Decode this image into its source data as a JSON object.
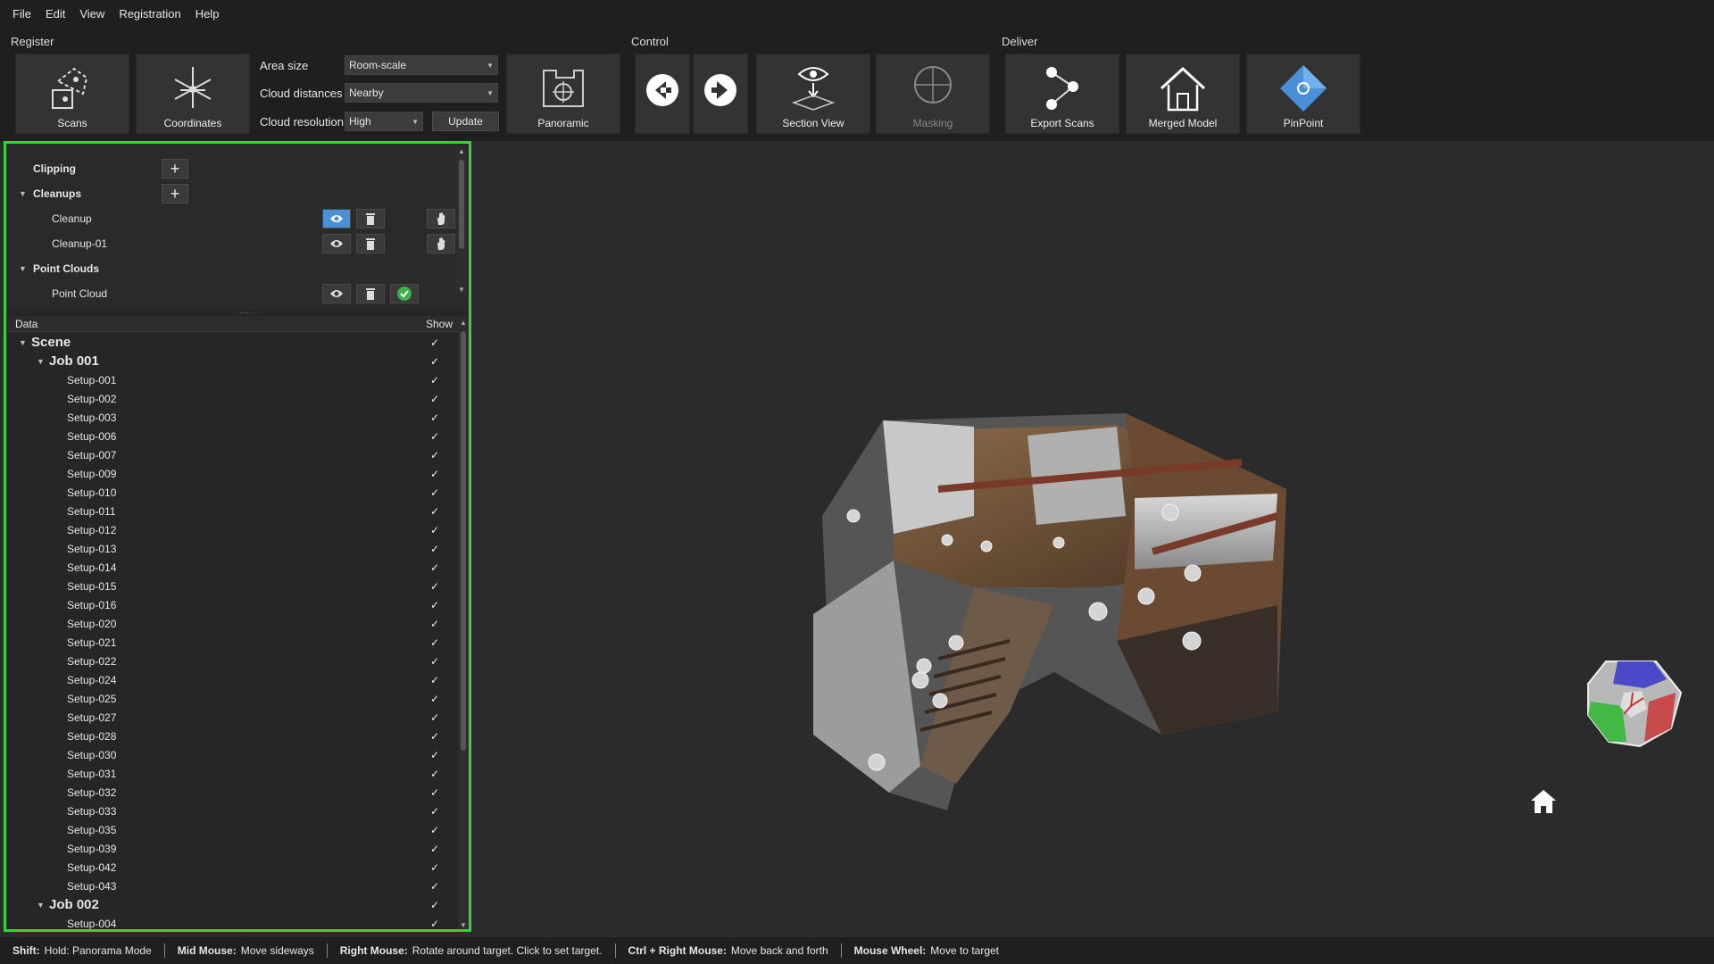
{
  "menu": [
    "File",
    "Edit",
    "View",
    "Registration",
    "Help"
  ],
  "toolbar": {
    "register_label": "Register",
    "control_label": "Control",
    "deliver_label": "Deliver",
    "scans": "Scans",
    "coordinates": "Coordinates",
    "area_size_label": "Area size",
    "area_size_value": "Room-scale",
    "cloud_distances_label": "Cloud distances",
    "cloud_distances_value": "Nearby",
    "cloud_resolution_label": "Cloud resolution",
    "cloud_resolution_value": "High",
    "update": "Update",
    "panoramic": "Panoramic",
    "section_view": "Section View",
    "masking": "Masking",
    "export_scans": "Export Scans",
    "merged_model": "Merged Model",
    "pinpoint": "PinPoint"
  },
  "panel": {
    "clipping": "Clipping",
    "cleanups": "Cleanups",
    "cleanup_items": [
      "Cleanup",
      "Cleanup-01"
    ],
    "point_clouds": "Point Clouds",
    "point_cloud_item": "Point Cloud",
    "data_header": "Data",
    "show_header": "Show"
  },
  "tree": {
    "scene": "Scene",
    "job1": "Job 001",
    "job1_setups": [
      "Setup-001",
      "Setup-002",
      "Setup-003",
      "Setup-006",
      "Setup-007",
      "Setup-009",
      "Setup-010",
      "Setup-011",
      "Setup-012",
      "Setup-013",
      "Setup-014",
      "Setup-015",
      "Setup-016",
      "Setup-020",
      "Setup-021",
      "Setup-022",
      "Setup-024",
      "Setup-025",
      "Setup-027",
      "Setup-028",
      "Setup-030",
      "Setup-031",
      "Setup-032",
      "Setup-033",
      "Setup-035",
      "Setup-039",
      "Setup-042",
      "Setup-043"
    ],
    "job2": "Job 002",
    "job2_setups": [
      "Setup-004"
    ],
    "check": "✓"
  },
  "status": [
    {
      "key": "Shift:",
      "text": "Hold: Panorama Mode"
    },
    {
      "key": "Mid Mouse:",
      "text": "Move sideways"
    },
    {
      "key": "Right Mouse:",
      "text": "Rotate around target. Click to set target."
    },
    {
      "key": "Ctrl + Right Mouse:",
      "text": "Move back and forth"
    },
    {
      "key": "Mouse Wheel:",
      "text": "Move to target"
    }
  ],
  "colors": {
    "highlight": "#3ad13a",
    "accent": "#4b8fd9"
  }
}
